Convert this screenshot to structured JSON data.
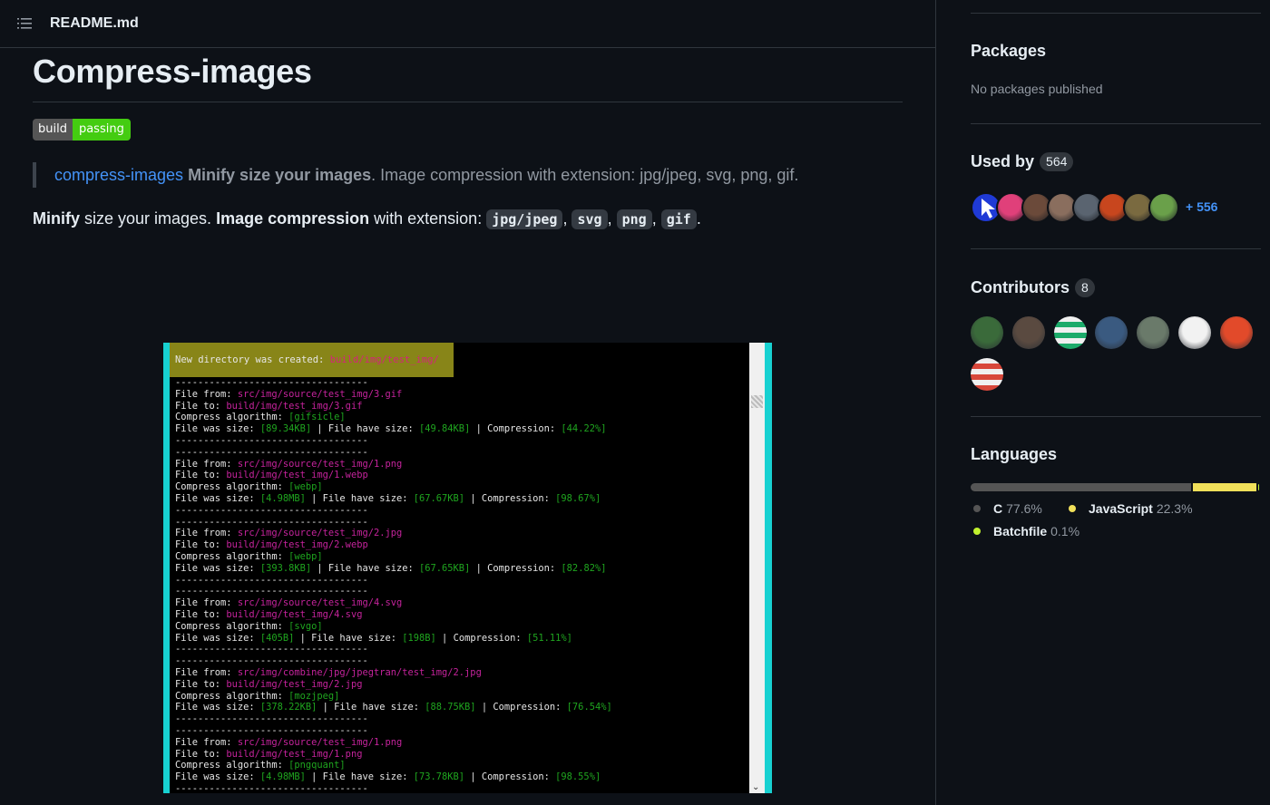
{
  "readme": {
    "filename": "README.md",
    "title": "Compress-images",
    "badge": {
      "left": "build",
      "right": "passing"
    },
    "quote": {
      "link": "compress-images",
      "bold": "Minify size your images",
      "rest": ". Image compression with extension: jpg/jpeg, svg, png, gif."
    },
    "para": {
      "b1": "Minify",
      "t1": " size your images. ",
      "b2": "Image compression",
      "t2": " with extension: ",
      "codes": [
        "jpg/jpeg",
        "svg",
        "png",
        "gif"
      ],
      "sep": ",",
      "end": "."
    },
    "terminal": {
      "banner_text": "New directory was created: ",
      "banner_path": "build/img/test_img/",
      "separator": "----------------------------------",
      "labels": {
        "from": "File from: ",
        "to": "File to: ",
        "algo": "Compress algorithm: ",
        "was": "File was size: ",
        "have": " | File have size: ",
        "comp": " | Compression: "
      },
      "blocks": [
        {
          "from": "src/img/source/test_img/3.gif",
          "to": "build/img/test_img/3.gif",
          "algo": "[gifsicle]",
          "was": "[89.34KB]",
          "have": "[49.84KB]",
          "comp": "[44.22%]"
        },
        {
          "from": "src/img/source/test_img/1.png",
          "to": "build/img/test_img/1.webp",
          "algo": "[webp]",
          "was": "[4.98MB]",
          "have": "[67.67KB]",
          "comp": "[98.67%]"
        },
        {
          "from": "src/img/source/test_img/2.jpg",
          "to": "build/img/test_img/2.webp",
          "algo": "[webp]",
          "was": "[393.8KB]",
          "have": "[67.65KB]",
          "comp": "[82.82%]"
        },
        {
          "from": "src/img/source/test_img/4.svg",
          "to": "build/img/test_img/4.svg",
          "algo": "[svgo]",
          "was": "[405B]",
          "have": "[198B]",
          "comp": "[51.11%]"
        },
        {
          "from": "src/img/combine/jpg/jpegtran/test_img/2.jpg",
          "to": "build/img/test_img/2.jpg",
          "algo": "[mozjpeg]",
          "was": "[378.22KB]",
          "have": "[88.75KB]",
          "comp": "[76.54%]"
        },
        {
          "from": "src/img/source/test_img/1.png",
          "to": "build/img/test_img/1.png",
          "algo": "[pngquant]",
          "was": "[4.98MB]",
          "have": "[73.78KB]",
          "comp": "[98.55%]"
        }
      ]
    }
  },
  "sidebar": {
    "packages": {
      "title": "Packages",
      "empty": "No packages published"
    },
    "used_by": {
      "title": "Used by",
      "count": "564",
      "more": "+ 556",
      "avatar_colors": [
        "#1f3ad6",
        "#e0407a",
        "#6b4a3a",
        "#8a6e5e",
        "#5a6470",
        "#c8461e",
        "#7a6a40",
        "#6aa04a"
      ]
    },
    "contributors": {
      "title": "Contributors",
      "count": "8",
      "avatar_colors": [
        "#3a6a3a",
        "#5a4a40",
        "#1cab6a",
        "#3a5a80",
        "#6a7a6a",
        "#f2f2f2",
        "#e24a2a",
        "#d8473a"
      ]
    },
    "languages": {
      "title": "Languages",
      "items": [
        {
          "name": "C",
          "pct": "77.6%",
          "value": 77.6,
          "color": "#555555"
        },
        {
          "name": "JavaScript",
          "pct": "22.3%",
          "value": 22.3,
          "color": "#f1e05a"
        },
        {
          "name": "Batchfile",
          "pct": "0.1%",
          "value": 0.1,
          "color": "#c1f12e"
        }
      ]
    }
  }
}
